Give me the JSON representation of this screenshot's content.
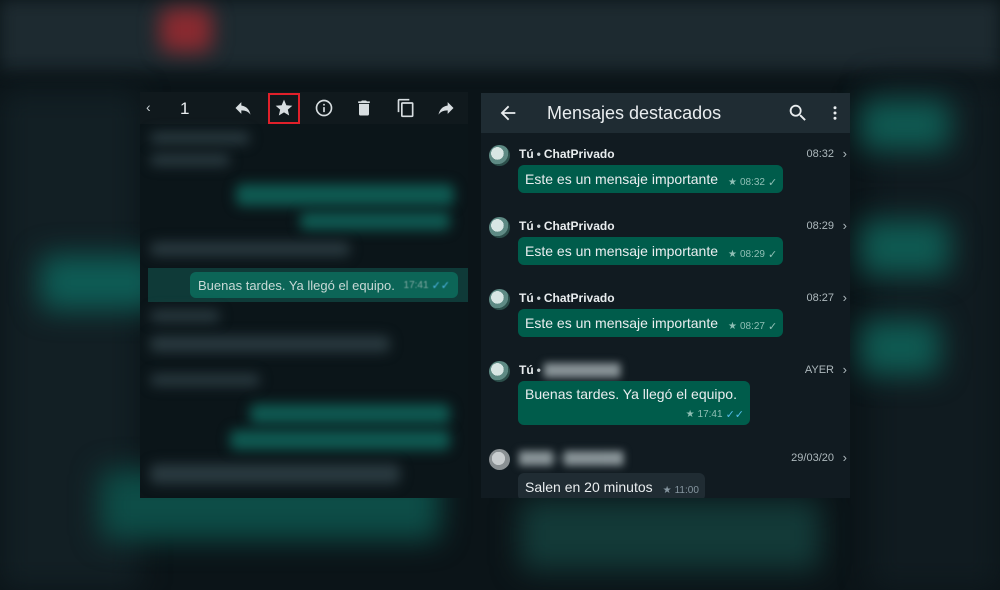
{
  "colors": {
    "header": "#1f2c33",
    "outgoing_bubble": "#005c4b",
    "incoming_bubble": "#202c33",
    "highlight_box": "#e0202a",
    "read_ticks": "#53bdeb"
  },
  "left_panel": {
    "selection_count": "1",
    "toolbar_icons": [
      "reply-icon",
      "star-icon",
      "info-icon",
      "delete-icon",
      "copy-icon",
      "forward-icon"
    ],
    "highlighted_message": {
      "text": "Buenas tardes. Ya llegó el equipo.",
      "time": "17:41"
    }
  },
  "right_panel": {
    "title": "Mensajes destacados",
    "messages": [
      {
        "sender": "Tú",
        "chat": "ChatPrivado",
        "date": "08:32",
        "text": "Este es un mensaje importante",
        "time": "08:32",
        "tick": "✓"
      },
      {
        "sender": "Tú",
        "chat": "ChatPrivado",
        "date": "08:29",
        "text": "Este es un mensaje importante",
        "time": "08:29",
        "tick": "✓"
      },
      {
        "sender": "Tú",
        "chat": "ChatPrivado",
        "date": "08:27",
        "text": "Este es un mensaje importante",
        "time": "08:27",
        "tick": "✓"
      },
      {
        "sender": "Tú",
        "chat": "",
        "date": "AYER",
        "text": "Buenas tardes. Ya llegó el equipo.",
        "time": "17:41",
        "tick": "✓✓"
      },
      {
        "sender": "",
        "chat": "",
        "date": "29/03/20",
        "text": "Salen en 20 minutos",
        "time": "11:00",
        "tick": ""
      }
    ]
  }
}
